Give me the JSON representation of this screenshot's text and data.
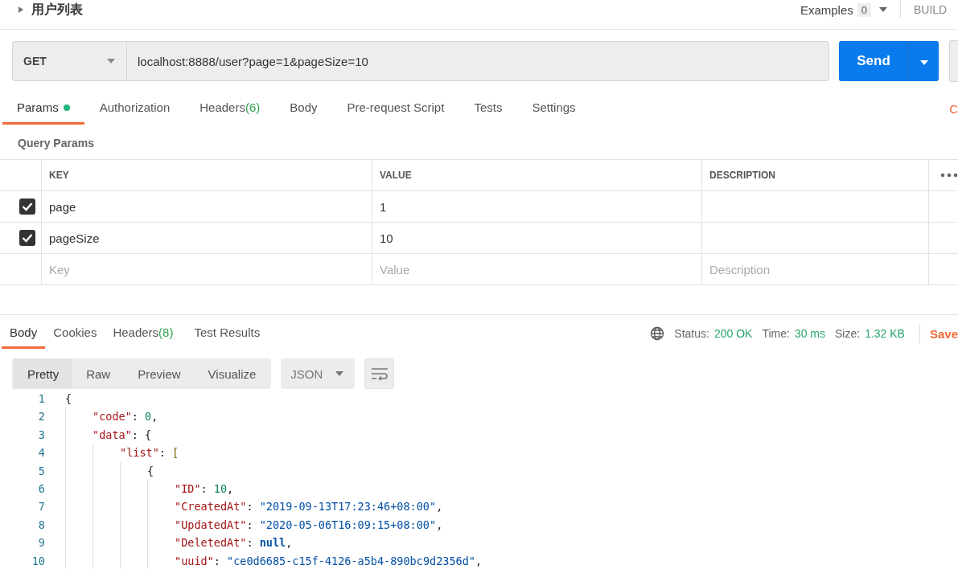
{
  "request": {
    "title": "用户列表",
    "examples_label": "Examples",
    "examples_count": "0",
    "build_label": "BUILD",
    "method": "GET",
    "url": "localhost:8888/user?page=1&pageSize=10",
    "send_label": "Send"
  },
  "request_tabs": [
    {
      "label": "Params",
      "selected": true,
      "indicator": true
    },
    {
      "label": "Authorization",
      "selected": false,
      "indicator": false
    },
    {
      "label": "Headers",
      "count": "(6)",
      "selected": false,
      "indicator": false
    },
    {
      "label": "Body",
      "selected": false,
      "indicator": false
    },
    {
      "label": "Pre-request Script",
      "selected": false,
      "indicator": false
    },
    {
      "label": "Tests",
      "selected": false,
      "indicator": false
    },
    {
      "label": "Settings",
      "selected": false,
      "indicator": false
    }
  ],
  "cut_link": "C",
  "query_params": {
    "title": "Query Params",
    "columns": [
      "KEY",
      "VALUE",
      "DESCRIPTION"
    ],
    "rows": [
      {
        "checked": true,
        "key": "page",
        "value": "1"
      },
      {
        "checked": true,
        "key": "pageSize",
        "value": "10"
      }
    ],
    "new_row": [
      {
        "placeholder": "Key"
      },
      {
        "placeholder": "Value"
      },
      {
        "placeholder": "Description"
      }
    ]
  },
  "response_tabs": [
    {
      "label": "Body",
      "selected": true
    },
    {
      "label": "Cookies",
      "selected": false
    },
    {
      "label": "Headers",
      "count": "(8)",
      "selected": false
    },
    {
      "label": "Test Results",
      "selected": false
    }
  ],
  "response_meta": {
    "status_label": "Status:",
    "status": "200 OK",
    "time_label": "Time:",
    "time": "30 ms",
    "size_label": "Size:",
    "size": "1.32 KB",
    "save_label": "Save"
  },
  "view_modes": [
    {
      "label": "Pretty",
      "selected": true
    },
    {
      "label": "Raw",
      "selected": false
    },
    {
      "label": "Preview",
      "selected": false
    },
    {
      "label": "Visualize",
      "selected": false
    }
  ],
  "format": "JSON",
  "code": [
    {
      "number": "1",
      "tokens": [
        {
          "kind": "punct",
          "text": "{"
        }
      ],
      "children": [
        {
          "number": "2",
          "tokens": [
            {
              "kind": "key",
              "text": "\"code\""
            },
            {
              "kind": "punct",
              "text": ": "
            },
            {
              "kind": "number",
              "text": "0"
            },
            {
              "kind": "punct",
              "text": ","
            }
          ]
        },
        {
          "number": "3",
          "tokens": [
            {
              "kind": "key",
              "text": "\"data\""
            },
            {
              "kind": "punct",
              "text": ": {"
            }
          ],
          "children": [
            {
              "number": "4",
              "tokens": [
                {
                  "kind": "key",
                  "text": "\"list\""
                },
                {
                  "kind": "punct",
                  "text": ": "
                },
                {
                  "kind": "bracket",
                  "text": "["
                }
              ],
              "children": [
                {
                  "number": "5",
                  "tokens": [
                    {
                      "kind": "punct",
                      "text": "{"
                    }
                  ],
                  "children": [
                    {
                      "number": "6",
                      "tokens": [
                        {
                          "kind": "key",
                          "text": "\"ID\""
                        },
                        {
                          "kind": "punct",
                          "text": ": "
                        },
                        {
                          "kind": "number",
                          "text": "10"
                        },
                        {
                          "kind": "punct",
                          "text": ","
                        }
                      ]
                    },
                    {
                      "number": "7",
                      "tokens": [
                        {
                          "kind": "key",
                          "text": "\"CreatedAt\""
                        },
                        {
                          "kind": "punct",
                          "text": ": "
                        },
                        {
                          "kind": "string",
                          "text": "\"2019-09-13T17:23:46+08:00\""
                        },
                        {
                          "kind": "punct",
                          "text": ","
                        }
                      ]
                    },
                    {
                      "number": "8",
                      "tokens": [
                        {
                          "kind": "key",
                          "text": "\"UpdatedAt\""
                        },
                        {
                          "kind": "punct",
                          "text": ": "
                        },
                        {
                          "kind": "string",
                          "text": "\"2020-05-06T16:09:15+08:00\""
                        },
                        {
                          "kind": "punct",
                          "text": ","
                        }
                      ]
                    },
                    {
                      "number": "9",
                      "tokens": [
                        {
                          "kind": "key",
                          "text": "\"DeletedAt\""
                        },
                        {
                          "kind": "punct",
                          "text": ": "
                        },
                        {
                          "kind": "null",
                          "text": "null"
                        },
                        {
                          "kind": "punct",
                          "text": ","
                        }
                      ]
                    },
                    {
                      "number": "10",
                      "tokens": [
                        {
                          "kind": "key",
                          "text": "\"uuid\""
                        },
                        {
                          "kind": "punct",
                          "text": ": "
                        },
                        {
                          "kind": "string",
                          "text": "\"ce0d6685-c15f-4126-a5b4-890bc9d2356d\""
                        },
                        {
                          "kind": "punct",
                          "text": ","
                        }
                      ]
                    }
                  ]
                }
              ]
            }
          ]
        }
      ]
    }
  ]
}
